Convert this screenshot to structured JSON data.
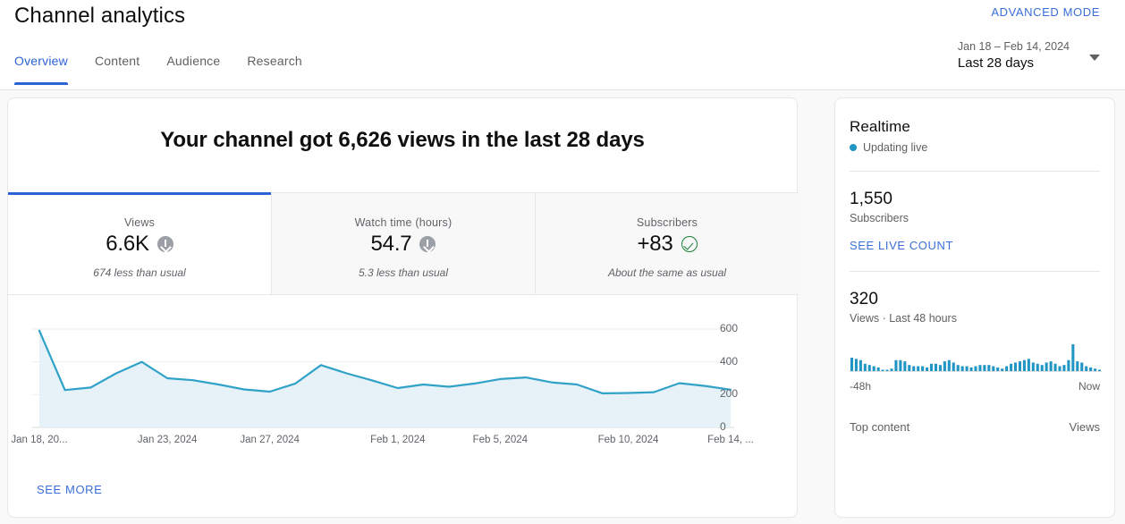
{
  "header": {
    "title": "Channel analytics",
    "advanced_mode": "ADVANCED MODE",
    "date_range_sub": "Jan 18 – Feb 14, 2024",
    "date_range_main": "Last 28 days",
    "tabs": [
      {
        "label": "Overview",
        "active": true
      },
      {
        "label": "Content",
        "active": false
      },
      {
        "label": "Audience",
        "active": false
      },
      {
        "label": "Research",
        "active": false
      }
    ]
  },
  "main": {
    "headline": "Your channel got 6,626 views in the last 28 days",
    "see_more": "SEE MORE",
    "metrics": [
      {
        "label": "Views",
        "value": "6.6K",
        "note": "674 less than usual",
        "icon": "down-arrow-circle-icon",
        "active": true
      },
      {
        "label": "Watch time (hours)",
        "value": "54.7",
        "note": "5.3 less than usual",
        "icon": "down-arrow-circle-icon",
        "active": false
      },
      {
        "label": "Subscribers",
        "value": "+83",
        "note": "About the same as usual",
        "icon": "check-circle-icon",
        "active": false
      }
    ]
  },
  "realtime": {
    "title": "Realtime",
    "live_status": "Updating live",
    "subscribers_value": "1,550",
    "subscribers_label": "Subscribers",
    "see_live_count": "SEE LIVE COUNT",
    "views_value": "320",
    "views_label": "Views · Last 48 hours",
    "spark_left_label": "-48h",
    "spark_right_label": "Now",
    "table_header_content": "Top content",
    "table_header_views": "Views"
  },
  "colors": {
    "accent_blue": "#2d62d4",
    "link_blue": "#3a6fd8",
    "chart_line": "#30a2c8",
    "chart_fill": "#e6f2f8",
    "realtime_bar": "#2196c4",
    "positive_green": "#188038",
    "neutral_gray": "#9aa0a6"
  },
  "chart_data": {
    "type": "area",
    "title": "",
    "xlabel": "",
    "ylabel": "Views",
    "ylim": [
      0,
      600
    ],
    "yticks": [
      0,
      200,
      400,
      600
    ],
    "grid": true,
    "legend": "none",
    "x_tick_labels": [
      "Jan 18, 20...",
      "Jan 23, 2024",
      "Jan 27, 2024",
      "Feb 1, 2024",
      "Feb 5, 2024",
      "Feb 10, 2024",
      "Feb 14, ..."
    ],
    "x": [
      "Jan 18, 2024",
      "Jan 19, 2024",
      "Jan 20, 2024",
      "Jan 21, 2024",
      "Jan 22, 2024",
      "Jan 23, 2024",
      "Jan 24, 2024",
      "Jan 25, 2024",
      "Jan 26, 2024",
      "Jan 27, 2024",
      "Jan 28, 2024",
      "Jan 29, 2024",
      "Jan 30, 2024",
      "Jan 31, 2024",
      "Feb 1, 2024",
      "Feb 2, 2024",
      "Feb 3, 2024",
      "Feb 4, 2024",
      "Feb 5, 2024",
      "Feb 6, 2024",
      "Feb 7, 2024",
      "Feb 8, 2024",
      "Feb 9, 2024",
      "Feb 10, 2024",
      "Feb 11, 2024",
      "Feb 12, 2024",
      "Feb 13, 2024",
      "Feb 14, 2024"
    ],
    "values": [
      590,
      228,
      243,
      330,
      400,
      300,
      288,
      262,
      232,
      218,
      268,
      380,
      330,
      287,
      240,
      262,
      248,
      268,
      295,
      305,
      275,
      262,
      208,
      210,
      215,
      270,
      253,
      230
    ],
    "series_name": "Views"
  },
  "realtime_sparkline": {
    "type": "bar",
    "title": "Views · Last 48 hours",
    "x_range_labels": [
      "-48h",
      "Now"
    ],
    "total": 320,
    "values": [
      11,
      10,
      9,
      6,
      5,
      4,
      3,
      1,
      1,
      2,
      9,
      9,
      8,
      5,
      4,
      4,
      4,
      3,
      6,
      6,
      5,
      8,
      9,
      7,
      5,
      4,
      4,
      3,
      4,
      5,
      5,
      5,
      4,
      3,
      2,
      4,
      6,
      7,
      8,
      9,
      10,
      7,
      6,
      5,
      7,
      8,
      6,
      4,
      5,
      9,
      22,
      8,
      7,
      4,
      3,
      2,
      1
    ]
  }
}
